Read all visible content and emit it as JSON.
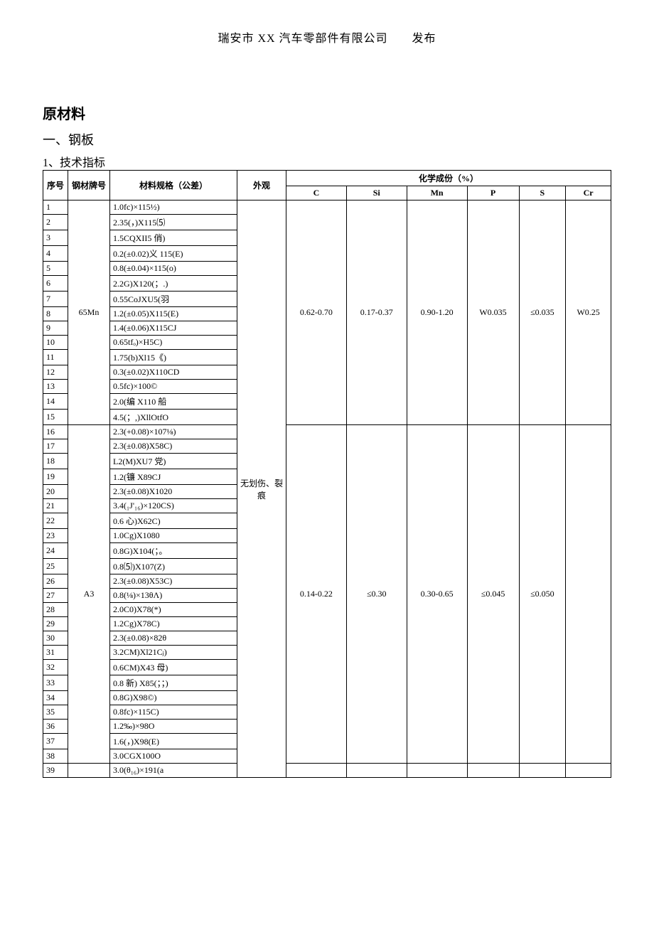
{
  "publisher": "瑞安市 XX 汽车零部件有限公司　　发布",
  "headings": {
    "material": "原材料",
    "steel": "一、钢板",
    "tech": "1、技术指标"
  },
  "table": {
    "head": {
      "seq": "序号",
      "grade": "钢材牌号",
      "spec": "材料规格（公差）",
      "appearance": "外观",
      "chem": "化学成份（%）",
      "C": "C",
      "Si": "Si",
      "Mn": "Mn",
      "P": "P",
      "S": "S",
      "Cr": "Cr"
    },
    "appearance_value": "无划伤、裂痕",
    "groups": [
      {
        "grade": "65Mn",
        "chem": {
          "C": "0.62-0.70",
          "Si": "0.17-0.37",
          "Mn": "0.90-1.20",
          "P": "W0.035",
          "S": "≤0.035",
          "Cr": "W0.25"
        },
        "rows": [
          {
            "seq": "1",
            "spec": "1.0fc)×115½)"
          },
          {
            "seq": "2",
            "spec": "2.35(，)X115⑸"
          },
          {
            "seq": "3",
            "spec": "1.5CQXII5 俏)"
          },
          {
            "seq": "4",
            "spec": "0.2(±0.02)义 115(E)"
          },
          {
            "seq": "5",
            "spec": "0.8(±0.04)×115(o)"
          },
          {
            "seq": "6",
            "spec": "2.2G)X120(；.)"
          },
          {
            "seq": "7",
            "spec": "0.55CoJXU5(羽"
          },
          {
            "seq": "8",
            "spec": "1.2(±0.05)X115(E)"
          },
          {
            "seq": "9",
            "spec": "1.4(±0.06)X115CJ"
          },
          {
            "seq": "10",
            "spec": "0.65tfₒ)×H5C)"
          },
          {
            "seq": "11",
            "spec": "1.75(b)Xl15《)"
          },
          {
            "seq": "12",
            "spec": "0.3(±0.02)X110CD"
          },
          {
            "seq": "13",
            "spec": "0.5fc)×100©"
          },
          {
            "seq": "14",
            "spec": "2.0(编 X110 船"
          },
          {
            "seq": "15",
            "spec": "4.5(；,)XllOtfO"
          }
        ]
      },
      {
        "grade": "A3",
        "chem": {
          "C": "0.14-0.22",
          "Si": "≤0.30",
          "Mn": "0.30-0.65",
          "P": "≤0.045",
          "S": "≤0.050",
          "Cr": ""
        },
        "rows": [
          {
            "seq": "16",
            "spec": "2.3(+0.08)×107⅛)"
          },
          {
            "seq": "17",
            "spec": "2.3(±0.08)X58C)"
          },
          {
            "seq": "18",
            "spec": "L2(M)XU7 党)"
          },
          {
            "seq": "19",
            "spec": "1.2(镰 X89CJ"
          },
          {
            "seq": "20",
            "spec": "2.3(±0.08)X1020"
          },
          {
            "seq": "21",
            "spec": "3.4(₁J'₁₆)×120CS)"
          },
          {
            "seq": "22",
            "spec": "0.6 心)X62C)"
          },
          {
            "seq": "23",
            "spec": "1.0Cg)X1080"
          },
          {
            "seq": "24",
            "spec": "0.8G)X104(；。"
          },
          {
            "seq": "25",
            "spec": "0.8⑸)X107(Z)"
          },
          {
            "seq": "26",
            "spec": "2.3(±0.08)X53C)"
          },
          {
            "seq": "27",
            "spec": "0.8(⅛)×13θΛ)"
          },
          {
            "seq": "28",
            "spec": "2.0C0)X78(*)"
          },
          {
            "seq": "29",
            "spec": "1.2Cg)X78C)"
          },
          {
            "seq": "30",
            "spec": "2.3(±0.08)×82θ"
          },
          {
            "seq": "31",
            "spec": "3.2CM)Xl21Cⱼ)"
          },
          {
            "seq": "32",
            "spec": "0.6CM)X43 母)"
          },
          {
            "seq": "33",
            "spec": "0.8 新) X85(；；)"
          },
          {
            "seq": "34",
            "spec": "0.8G)X98©)"
          },
          {
            "seq": "35",
            "spec": "0.8fc)×115C)"
          },
          {
            "seq": "36",
            "spec": "1.2‰)×98O"
          },
          {
            "seq": "37",
            "spec": "1.6(，)X98(E)"
          },
          {
            "seq": "38",
            "spec": "3.0CGX100O"
          }
        ]
      },
      {
        "grade": "",
        "chem": {
          "C": "",
          "Si": "",
          "Mn": "",
          "P": "",
          "S": "",
          "Cr": ""
        },
        "rows": [
          {
            "seq": "39",
            "spec": "3.0(θ₁₆)×191(a"
          }
        ]
      }
    ]
  }
}
